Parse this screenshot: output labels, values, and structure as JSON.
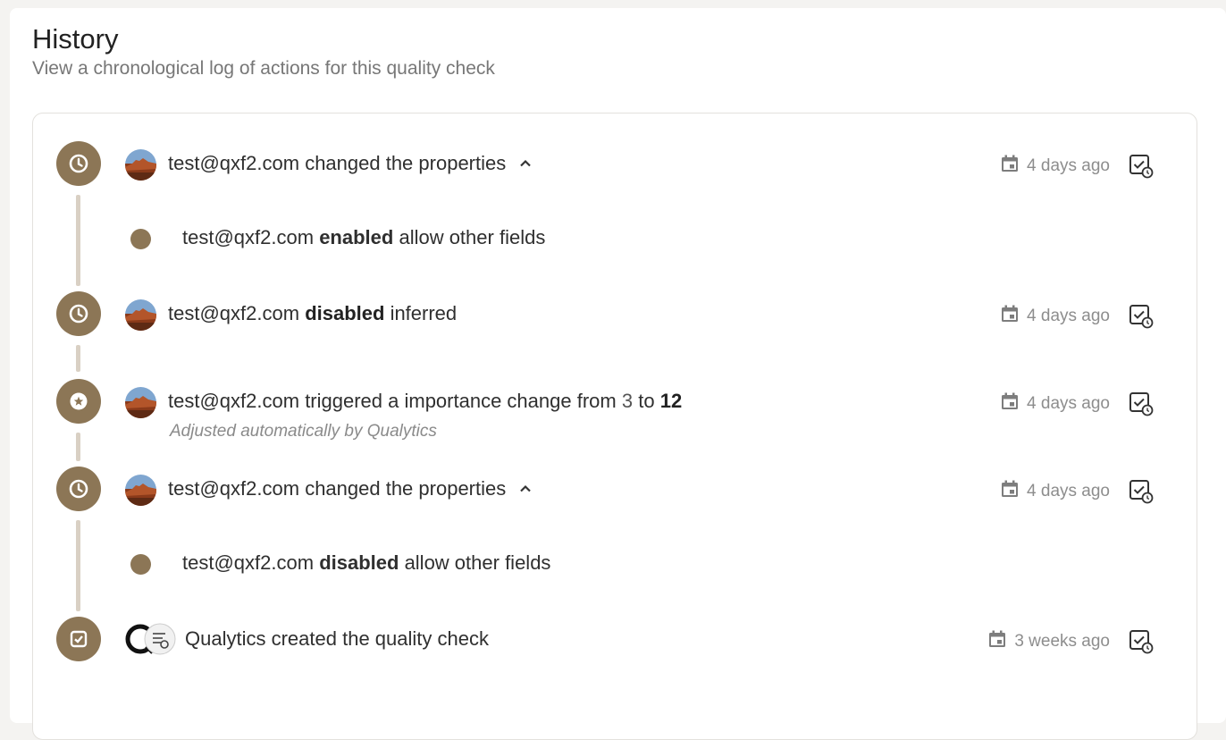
{
  "header": {
    "title": "History",
    "subtitle": "View a chronological log of actions for this quality check"
  },
  "entries": [
    {
      "icon": "clock-icon",
      "user": "test@qxf2.com",
      "text": "changed the properties",
      "time": "4 days ago",
      "expanded": true,
      "details": [
        {
          "user": "test@qxf2.com",
          "action": "enabled",
          "field": "allow other fields"
        }
      ]
    },
    {
      "icon": "clock-icon",
      "user": "test@qxf2.com",
      "action": "disabled",
      "field": "inferred",
      "time": "4 days ago"
    },
    {
      "icon": "star-icon",
      "user": "test@qxf2.com",
      "text": "triggered a importance change from",
      "from": "3",
      "to_word": "to",
      "to": "12",
      "note": "Adjusted automatically by Qualytics",
      "time": "4 days ago"
    },
    {
      "icon": "clock-icon",
      "user": "test@qxf2.com",
      "text": "changed the properties",
      "time": "4 days ago",
      "expanded": true,
      "details": [
        {
          "user": "test@qxf2.com",
          "action": "disabled",
          "field": "allow other fields"
        }
      ]
    },
    {
      "icon": "check-square-icon",
      "user": "Qualytics",
      "text": "created the quality check",
      "time": "3 weeks ago"
    }
  ],
  "colors": {
    "accent": "#8c7656",
    "timeline": "#d9d0c4",
    "muted": "#8d8d8d"
  }
}
